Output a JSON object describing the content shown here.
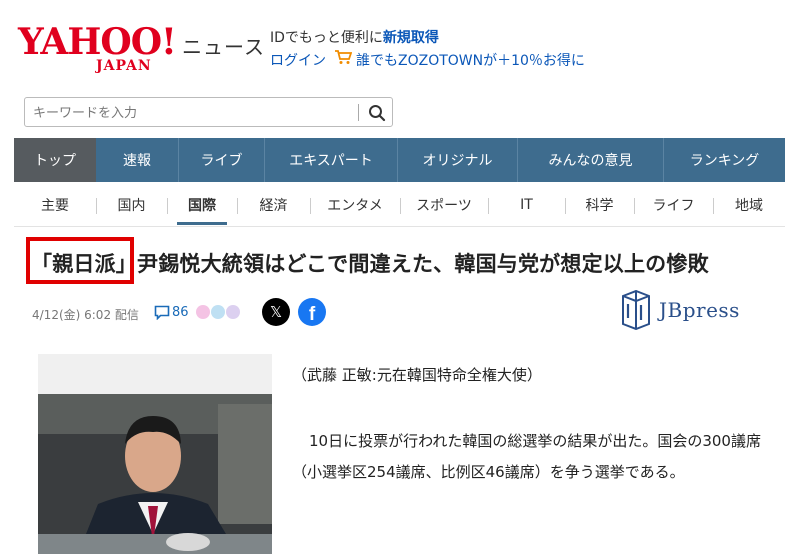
{
  "header": {
    "logo_yahoo": "YAHOO!",
    "logo_japan": "JAPAN",
    "service_name": "ニュース",
    "promo_id_text": "IDでもっと便利に",
    "promo_id_link": "新規取得",
    "login_label": "ログイン",
    "promo_zozo": "誰でもZOZOTOWNが＋10％お得に",
    "brand_color": "#e0001e"
  },
  "search": {
    "placeholder": "キーワードを入力",
    "button_icon": "search-icon"
  },
  "main_nav": {
    "active_color": "#565b5f",
    "bg_color": "#3e6c8e",
    "items": [
      {
        "label": "トップ"
      },
      {
        "label": "速報"
      },
      {
        "label": "ライブ"
      },
      {
        "label": "エキスパート"
      },
      {
        "label": "オリジナル"
      },
      {
        "label": "みんなの意見"
      },
      {
        "label": "ランキング"
      }
    ]
  },
  "category_nav": {
    "items": [
      {
        "label": "主要"
      },
      {
        "label": "国内"
      },
      {
        "label": "国際"
      },
      {
        "label": "経済"
      },
      {
        "label": "エンタメ"
      },
      {
        "label": "スポーツ"
      },
      {
        "label": "IT"
      },
      {
        "label": "科学"
      },
      {
        "label": "ライフ"
      },
      {
        "label": "地域"
      }
    ],
    "active": "国際"
  },
  "article": {
    "headline": "「親日派」尹錫悦大統領はどこで間違えた、韓国与党が想定以上の惨敗",
    "date": "4/12(金) 6:02 配信",
    "comment_count": "86",
    "share_x": "𝕏",
    "share_fb": "f",
    "publisher": "JBpress",
    "author": "（武藤 正敏:元在韓国特命全権大使）",
    "body": "10日に投票が行われた韓国の総選挙の結果が出た。国会の300議席（小選挙区254議席、比例区46議席）を争う選挙である。"
  }
}
